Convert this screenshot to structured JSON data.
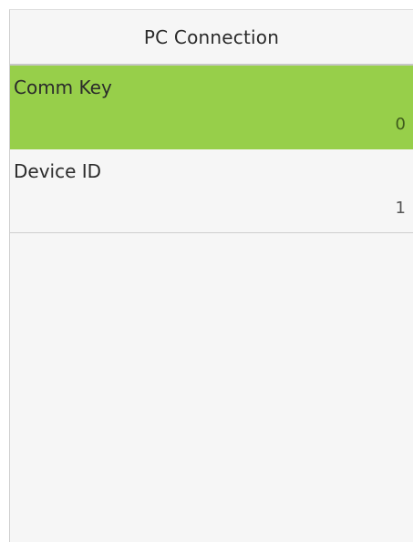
{
  "header": {
    "title": "PC Connection"
  },
  "menu": {
    "items": [
      {
        "label": "Comm Key",
        "value": "0",
        "selected": true
      },
      {
        "label": "Device ID",
        "value": "1",
        "selected": false
      }
    ]
  },
  "colors": {
    "selected_background": "#97cf4a",
    "screen_background": "#f6f6f6"
  }
}
